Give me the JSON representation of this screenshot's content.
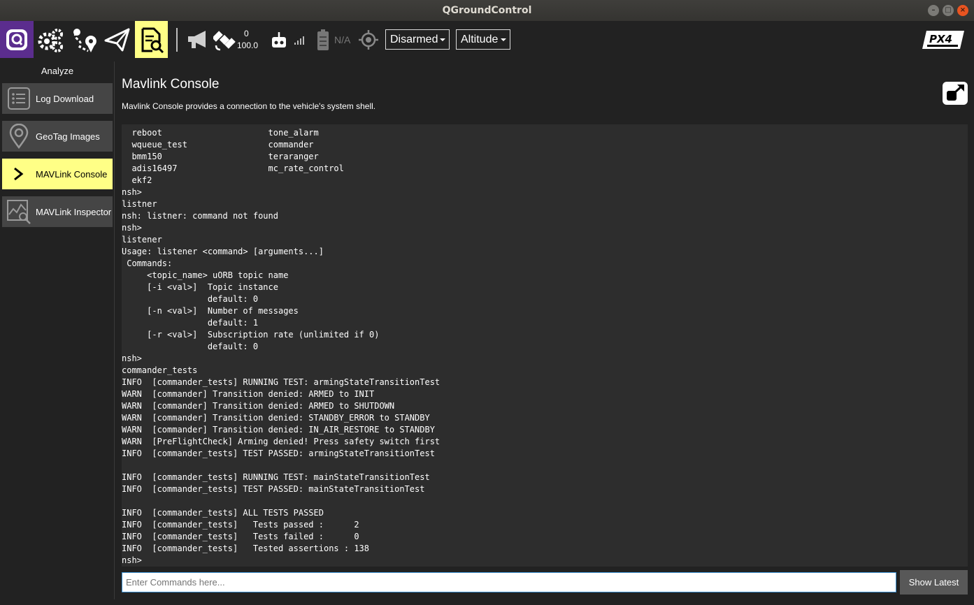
{
  "window": {
    "title": "QGroundControl"
  },
  "toolbar": {
    "gps_count": "0",
    "gps_hdop": "100.0",
    "battery": "N/A",
    "arm_state": "Disarmed",
    "flight_mode": "Altitude"
  },
  "sidebar": {
    "title": "Analyze",
    "items": [
      {
        "label": "Log Download",
        "active": false
      },
      {
        "label": "GeoTag Images",
        "active": false
      },
      {
        "label": "MAVLink Console",
        "active": true
      },
      {
        "label": "MAVLink Inspector",
        "active": false
      }
    ]
  },
  "main": {
    "title": "Mavlink Console",
    "description": "Mavlink Console provides a connection to the vehicle's system shell.",
    "console_text": "  reboot                     tone_alarm\n  wqueue_test                commander\n  bmm150                     teraranger\n  adis16497                  mc_rate_control\n  ekf2\nnsh>\nlistner\nnsh: listner: command not found\nnsh>\nlistener\nUsage: listener <command> [arguments...]\n Commands:\n     <topic_name> uORB topic name\n     [-i <val>]  Topic instance\n                 default: 0\n     [-n <val>]  Number of messages\n                 default: 1\n     [-r <val>]  Subscription rate (unlimited if 0)\n                 default: 0\nnsh>\ncommander_tests\nINFO  [commander_tests] RUNNING TEST: armingStateTransitionTest\nWARN  [commander] Transition denied: ARMED to INIT\nWARN  [commander] Transition denied: ARMED to SHUTDOWN\nWARN  [commander] Transition denied: STANDBY_ERROR to STANDBY\nWARN  [commander] Transition denied: IN_AIR_RESTORE to STANDBY\nWARN  [PreFlightCheck] Arming denied! Press safety switch first\nINFO  [commander_tests] TEST PASSED: armingStateTransitionTest\n\nINFO  [commander_tests] RUNNING TEST: mainStateTransitionTest\nINFO  [commander_tests] TEST PASSED: mainStateTransitionTest\n\nINFO  [commander_tests] ALL TESTS PASSED\nINFO  [commander_tests]   Tests passed :      2\nINFO  [commander_tests]   Tests failed :      0\nINFO  [commander_tests]   Tested assertions : 138\nnsh>",
    "input_placeholder": "Enter Commands here...",
    "show_latest_label": "Show Latest"
  },
  "colors": {
    "active": "#ffff86",
    "background": "#222222",
    "console_bg": "#2d2d2d",
    "qgc_purple": "#5b2d8e"
  }
}
